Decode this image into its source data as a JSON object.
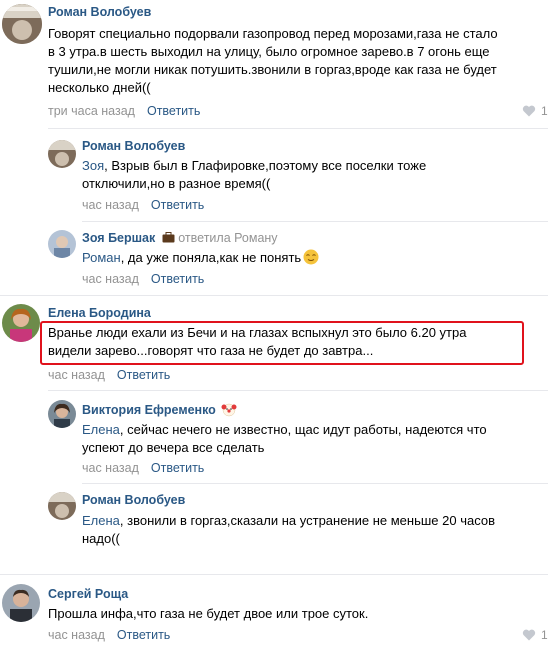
{
  "comments": [
    {
      "author": "Роман Волобуев",
      "lines": [
        "Говорят специально подорвали газопровод перед морозами,газа не стало",
        "в 3 утра.в шесть выходил на улицу, было огромное зарево.в 7 огонь еще",
        "тушили,не могли никак потушить.звонили в горгаз,вроде как газа не будет",
        "несколько дней(("
      ],
      "time": "три часа назад",
      "reply_label": "Ответить",
      "likes": "1",
      "avatar_colors": [
        "#8a7a6a",
        "#d8d0c4"
      ]
    },
    {
      "author": "Роман Волобуев",
      "mention": "Зоя",
      "lines": [
        ", Взрыв был в Глафировке,поэтому все поселки тоже",
        "отключили,но в разное время(("
      ],
      "time": "час назад",
      "reply_label": "Ответить"
    },
    {
      "author": "Зоя Бершак",
      "replied_to": "ответила Роману",
      "mention": "Роман",
      "lines": [
        ", да уже поняла,как не понять"
      ],
      "time": "час назад",
      "reply_label": "Ответить"
    },
    {
      "author": "Елена Бородина",
      "lines": [
        "Вранье люди ехали из Бечи и на глазах вспыхнул это было 6.20 утра",
        "видели зарево...говорят что газа не будет до завтра..."
      ],
      "time": "час назад",
      "reply_label": "Ответить"
    },
    {
      "author": "Виктория Ефременко",
      "mention": "Елена",
      "lines": [
        ", сейчас нечего не известно, щас идут работы, надеются что",
        "успеют до вечера все сделать"
      ],
      "time": "час назад",
      "reply_label": "Ответить"
    },
    {
      "author": "Роман Волобуев",
      "mention": "Елена",
      "lines": [
        ", звонили в горгаз,сказали на устранение не меньше 20 часов",
        "надо(("
      ],
      "time": "час назад",
      "reply_label": "Ответить"
    },
    {
      "author": "Сергей Роща",
      "lines": [
        "Прошла инфа,что газа не будет двое или трое суток."
      ],
      "time": "час назад",
      "reply_label": "Ответить",
      "likes": "1"
    }
  ],
  "colors": {
    "link": "#2a5885",
    "meta": "#939393",
    "highlight": "#e0121c",
    "divider": "#e7e8ec"
  }
}
